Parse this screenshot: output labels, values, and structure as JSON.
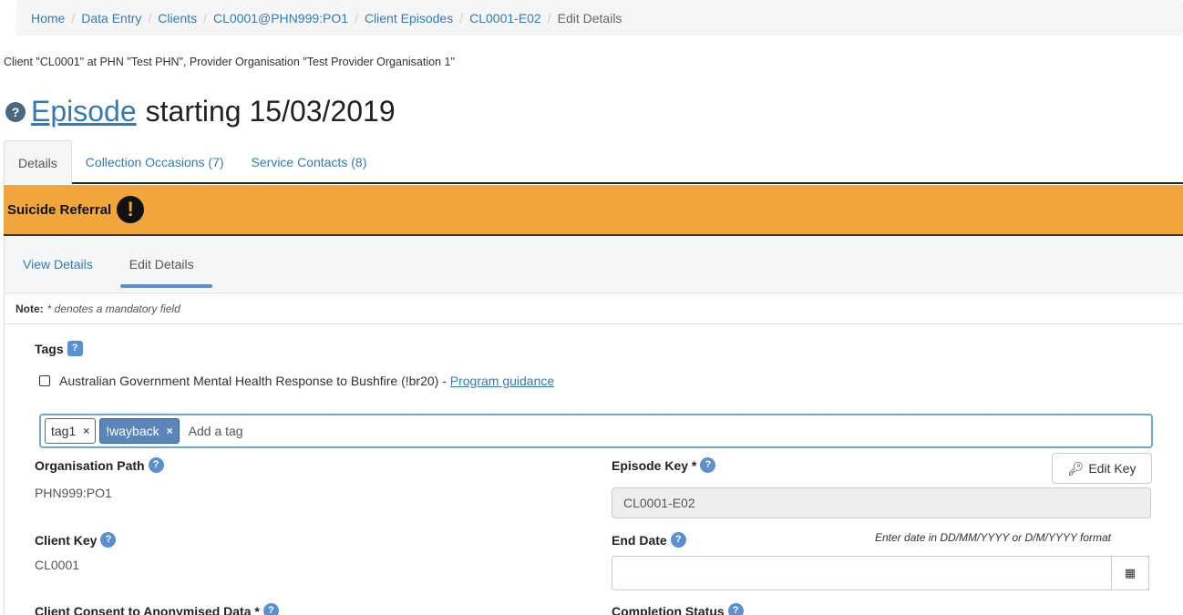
{
  "breadcrumb": [
    {
      "label": "Home"
    },
    {
      "label": "Data Entry"
    },
    {
      "label": "Clients"
    },
    {
      "label": "CL0001@PHN999:PO1"
    },
    {
      "label": "Client Episodes"
    },
    {
      "label": "CL0001-E02"
    },
    {
      "label": "Edit Details"
    }
  ],
  "client_info": "Client \"CL0001\" at PHN \"Test PHN\", Provider Organisation \"Test Provider Organisation 1\"",
  "title": {
    "help": "?",
    "link": "Episode",
    "rest": "starting 15/03/2019"
  },
  "tabs": [
    {
      "label": "Details"
    },
    {
      "label": "Collection Occasions (7)"
    },
    {
      "label": "Service Contacts (8)"
    }
  ],
  "referral": {
    "label": "Suicide Referral",
    "icon": "!"
  },
  "subtabs": [
    {
      "label": "View Details"
    },
    {
      "label": "Edit Details"
    }
  ],
  "note": {
    "bold": "Note:",
    "text": "* denotes a mandatory field"
  },
  "tags_section": {
    "label": "Tags",
    "checkbox_label": "Australian Government Mental Health Response to Bushfire (!br20) -",
    "guidance_link": "Program guidance",
    "tags": [
      {
        "label": "tag1",
        "remove": "×"
      },
      {
        "label": "!wayback",
        "remove": "×"
      }
    ],
    "placeholder": "Add a tag"
  },
  "fields": {
    "org_path_label": "Organisation Path",
    "org_path_value": "PHN999:PO1",
    "episode_key_label": "Episode Key *",
    "edit_key_button": "Edit Key",
    "episode_key_value": "CL0001-E02",
    "client_key_label": "Client Key",
    "client_key_value": "CL0001",
    "end_date_label": "End Date",
    "end_date_hint": "Enter date in DD/MM/YYYY or D/M/YYYY format",
    "consent_label": "Client Consent to Anonymised Data *",
    "completion_label": "Completion Status"
  },
  "help_glyph": "?",
  "icons": {
    "help": "help-icon",
    "alert": "exclamation-icon",
    "key": "key-icon",
    "calendar": "calendar-icon",
    "checkbox": "checkbox-icon"
  },
  "colors": {
    "link": "#337ab7",
    "referral_banner": "#f0a63a",
    "help_badge": "#5a8fd0",
    "tag_selected": "#5a86bd",
    "focus_border": "#6ea6da"
  }
}
